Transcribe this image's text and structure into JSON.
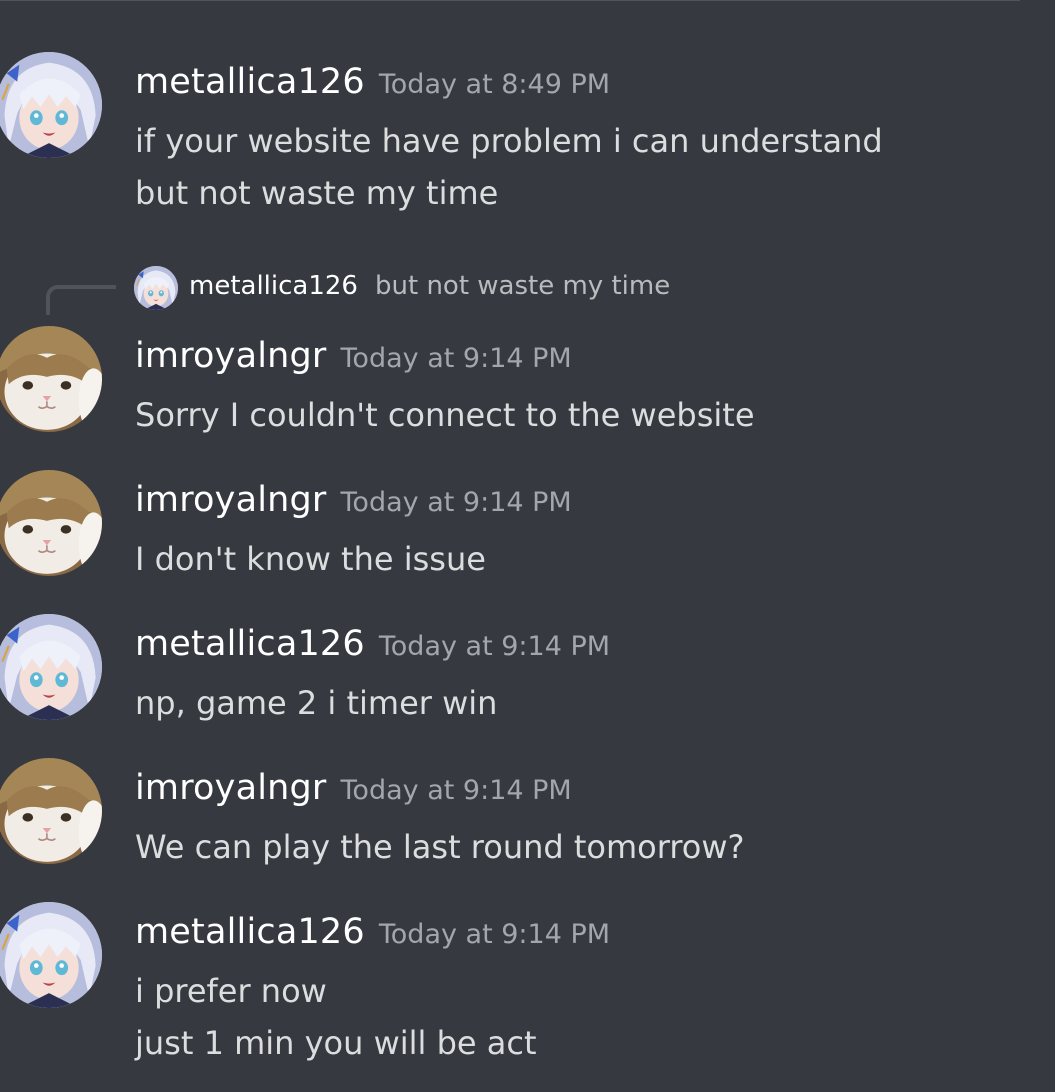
{
  "messages": [
    {
      "author": "metallica126",
      "avatar": "anime-girl-avatar-icon",
      "timestamp": "Today at 8:49 PM",
      "lines": [
        "if your website have problem i can understand",
        "but not waste my time"
      ]
    },
    {
      "reply_to": {
        "author": "metallica126",
        "avatar": "anime-girl-avatar-icon",
        "preview": "but not waste my time"
      },
      "author": "imroyalngr",
      "avatar": "cat-avatar-icon",
      "timestamp": "Today at 9:14 PM",
      "lines": [
        "Sorry I couldn't connect to the website"
      ]
    },
    {
      "author": "imroyalngr",
      "avatar": "cat-avatar-icon",
      "timestamp": "Today at 9:14 PM",
      "lines": [
        "I don't know the issue"
      ]
    },
    {
      "author": "metallica126",
      "avatar": "anime-girl-avatar-icon",
      "timestamp": "Today at 9:14 PM",
      "lines": [
        "np, game 2 i timer win"
      ]
    },
    {
      "author": "imroyalngr",
      "avatar": "cat-avatar-icon",
      "timestamp": "Today at 9:14 PM",
      "lines": [
        "We can play the last round tomorrow?"
      ]
    },
    {
      "author": "metallica126",
      "avatar": "anime-girl-avatar-icon",
      "timestamp": "Today at 9:14 PM",
      "lines": [
        "i prefer now",
        "just 1 min you will be act"
      ]
    }
  ],
  "colors": {
    "background": "#36393f",
    "username": "#ffffff",
    "timestamp": "#a3a6aa",
    "message_text": "#dcddde",
    "reply_spine": "#4f545c"
  }
}
